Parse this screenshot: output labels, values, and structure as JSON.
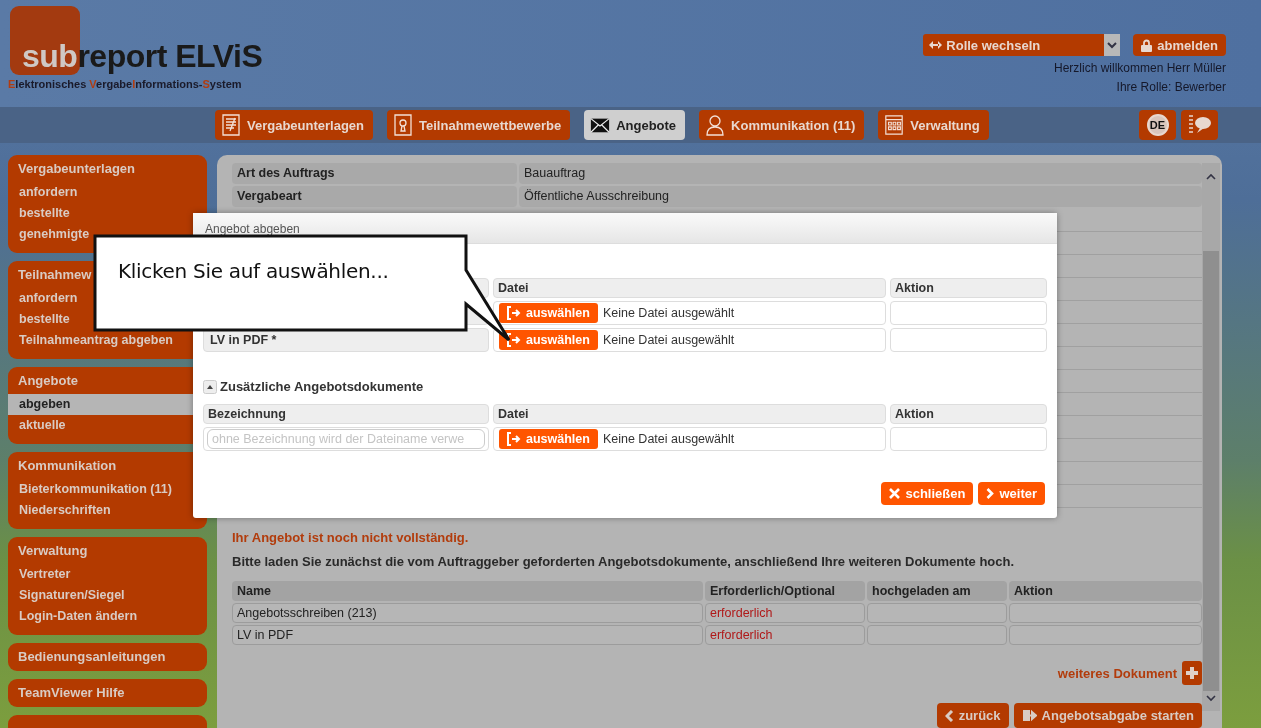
{
  "header": {
    "logo_highlight": "sub",
    "logo_rest": "report ELViS",
    "tagline": [
      {
        "text": "E",
        "accent": true
      },
      {
        "text": "lektronisches ",
        "accent": false
      },
      {
        "text": "V",
        "accent": true
      },
      {
        "text": "ergabe",
        "accent": false
      },
      {
        "text": "I",
        "accent": true
      },
      {
        "text": "nformations-",
        "accent": false
      },
      {
        "text": "S",
        "accent": true
      },
      {
        "text": "ystem",
        "accent": false
      }
    ],
    "role_switch": "Rolle wechseln",
    "logout": "abmelden",
    "welcome": "Herzlich willkommen Herr Müller",
    "role": "Ihre Rolle: Bewerber"
  },
  "nav": [
    {
      "label": "Vergabeunterlagen",
      "selected": false
    },
    {
      "label": "Teilnahmewettbewerbe",
      "selected": false
    },
    {
      "label": "Angebote",
      "selected": true
    },
    {
      "label": "Kommunikation (11)",
      "selected": false
    },
    {
      "label": "Verwaltung",
      "selected": false
    }
  ],
  "language": "DE",
  "sidebar": [
    {
      "title": "Vergabeunterlagen",
      "items": [
        {
          "label": "anfordern",
          "selected": false
        },
        {
          "label": "bestellte",
          "selected": false
        },
        {
          "label": "genehmigte",
          "selected": false
        }
      ]
    },
    {
      "title": "Teilnahmew",
      "items": [
        {
          "label": "anfordern",
          "selected": false
        },
        {
          "label": "bestellte",
          "selected": false
        },
        {
          "label": "Teilnahmeantrag abgeben",
          "selected": false
        }
      ]
    },
    {
      "title": "Angebote",
      "items": [
        {
          "label": "abgeben",
          "selected": true
        },
        {
          "label": "aktuelle",
          "selected": false
        }
      ]
    },
    {
      "title": "Kommunikation",
      "items": [
        {
          "label": "Bieterkommunikation (11)",
          "selected": false
        },
        {
          "label": "Niederschriften",
          "selected": false
        }
      ]
    },
    {
      "title": "Verwaltung",
      "items": [
        {
          "label": "Vertreter",
          "selected": false
        },
        {
          "label": "Signaturen/Siegel",
          "selected": false
        },
        {
          "label": "Login-Daten ändern",
          "selected": false
        }
      ]
    },
    {
      "title": "Bedienungsanleitungen"
    },
    {
      "title": "TeamViewer Hilfe"
    }
  ],
  "details": [
    {
      "label": "Art des Auftrags",
      "value": "Bauauftrag"
    },
    {
      "label": "Vergabeart",
      "value": "Öffentliche Ausschreibung"
    }
  ],
  "warning": "Ihr Angebot ist noch nicht vollständig.",
  "instruction": "Bitte laden Sie zunächst die vom Auftraggeber geforderten Angebotsdokumente, anschließend Ihre weiteren Dokumente hoch.",
  "documents": {
    "columns": [
      "Name",
      "Erforderlich/Optional",
      "hochgeladen am",
      "Aktion"
    ],
    "rows": [
      {
        "name": "Angebotsschreiben (213)",
        "requirement": "erforderlich"
      },
      {
        "name": "LV in PDF",
        "requirement": "erforderlich"
      }
    ]
  },
  "add_document": "weiteres Dokument",
  "back_button": "zurück",
  "start_button": "Angebotsabgabe starten",
  "modal": {
    "title": "Angebot abgeben",
    "required": {
      "columns": [
        "Datei",
        "Aktion"
      ],
      "rows": [
        {
          "file_button": "auswählen",
          "file_status": "Keine Datei ausgewählt"
        },
        {
          "label": "LV in PDF *",
          "file_button": "auswählen",
          "file_status": "Keine Datei ausgewählt"
        }
      ]
    },
    "section": {
      "title": "Zusätzliche Angebotsdokumente",
      "expanded": true
    },
    "extra": {
      "columns": [
        "Bezeichnung",
        "Datei",
        "Aktion"
      ],
      "rows": [
        {
          "placeholder": "ohne Bezeichnung wird der Dateiname verwe",
          "file_button": "auswählen",
          "file_status": "Keine Datei ausgewählt"
        }
      ]
    },
    "close_button": "schließen",
    "next_button": "weiter"
  },
  "callout": "Klicken Sie auf auswählen..."
}
